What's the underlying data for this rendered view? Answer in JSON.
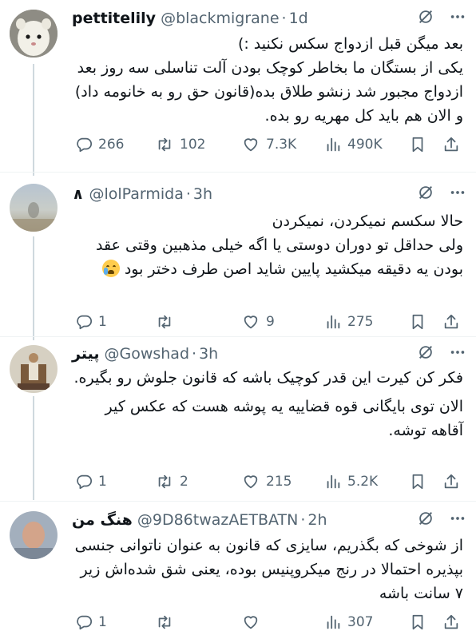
{
  "tweets": [
    {
      "name": "pettitelily",
      "handle": "@blackmigrane",
      "time": "1d",
      "text": [
        "بعد میگن قبل ازدواج سکس نکنید :)",
        "یکی از بستگان ما بخاطر کوچک بودن آلت تناسلی سه روز بعد ازدواج مجبور شد زنشو طلاق بده(قانون حق رو به خانومه داد) و الان هم باید کل مهریه رو بده."
      ],
      "replies": "266",
      "reposts": "102",
      "likes": "7.3K",
      "views": "490K",
      "avatar_colors": [
        "#9a9a92",
        "#f4f2ea"
      ]
    },
    {
      "name": "‏∧",
      "handle": "@lolParmida",
      "time": "3h",
      "text": [
        "حالا سکسم نمیکردن، نمیکردن",
        "ولی حداقل تو دوران دوستی یا اگه خیلی مذهبین وقتی عقد بودن یه دقیقه میکشید پایین شاید اصن طرف دختر بود"
      ],
      "emoji": "crying-face-emoji",
      "replies": "1",
      "reposts": "",
      "likes": "9",
      "views": "275",
      "avatar_colors": [
        "#8fa3b8",
        "#c9c4b2"
      ]
    },
    {
      "name": "پیتر",
      "handle": "@Gowshad",
      "time": "3h",
      "text": [
        "فکر کن کیرت این قدر کوچیک باشه که قانون جلوش رو بگیره.",
        "الان توی بایگانی قوه قضاییه یه پوشه هست که عکس کیر آقاهه توشه."
      ],
      "replies": "1",
      "reposts": "2",
      "likes": "215",
      "views": "5.2K",
      "avatar_colors": [
        "#cfc8b8",
        "#8a6a4a"
      ]
    },
    {
      "name": "هنگ من",
      "handle": "@9D86twazAETBATN",
      "time": "2h",
      "text": [
        "از شوخی که بگذریم، سایزی که قانون به عنوان ناتوانی جنسی بپذیره احتمالا در رنج میکروپنیس بوده، یعنی شق شده‌اش زیر ۷ سانت باشه"
      ],
      "replies": "1",
      "reposts": "",
      "likes": "",
      "views": "307",
      "avatar_colors": [
        "#9aa8b8",
        "#d8a890"
      ]
    }
  ],
  "separator": "·",
  "icon_color": "#536471",
  "thread_line_color": "#cfd9de"
}
